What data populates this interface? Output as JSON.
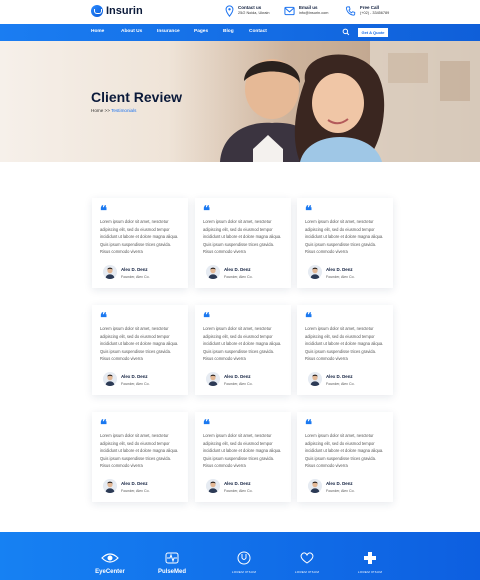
{
  "brand": {
    "name": "Insurin"
  },
  "contact": [
    {
      "icon": "location-pin-icon",
      "label": "Contact us",
      "value": "25/2 Noida, Ukrain"
    },
    {
      "icon": "email-icon",
      "label": "Email us",
      "value": "info@insurin.com"
    },
    {
      "icon": "phone-icon",
      "label": "Free Call",
      "value": "(+02) - 33456789"
    }
  ],
  "nav": {
    "items": [
      "Home",
      "About Us",
      "Insurance",
      "Pages",
      "Blog",
      "Contact"
    ],
    "cta": "Get A Quote"
  },
  "hero": {
    "title": "Client Review",
    "crumb_home": "Home",
    "crumb_sep": ">>",
    "crumb_current": "Testimonials"
  },
  "testimonials": [
    {
      "text": "Lorem ipsum dolor sit amet, nesctetur adipiscing elit, sed do eiusmod tempor incididunt ut labore et dolore magna aliqua. Quis ipsum suspendisse trices gravida. Risus commodo viverra",
      "name": "Alex D. Denz",
      "role": "Founder, Alex Co."
    },
    {
      "text": "Lorem ipsum dolor sit amet, nesctetur adipiscing elit, sed do eiusmod tempor incididunt ut labore et dolore magna aliqua. Quis ipsum suspendisse trices gravida. Risus commodo viverra",
      "name": "Alex D. Denz",
      "role": "Founder, Alex Co."
    },
    {
      "text": "Lorem ipsum dolor sit amet, nesctetur adipiscing elit, sed do eiusmod tempor incididunt ut labore et dolore magna aliqua. Quis ipsum suspendisse trices gravida. Risus commodo viverra",
      "name": "Alex D. Denz",
      "role": "Founder, Alex Co."
    },
    {
      "text": "Lorem ipsum dolor sit amet, nesctetur adipiscing elit, sed do eiusmod tempor incididunt ut labore et dolore magna aliqua. Quis ipsum suspendisse trices gravida. Risus commodo viverra",
      "name": "Alex D. Denz",
      "role": "Founder, Alex Co."
    },
    {
      "text": "Lorem ipsum dolor sit amet, nesctetur adipiscing elit, sed do eiusmod tempor incididunt ut labore et dolore magna aliqua. Quis ipsum suspendisse trices gravida. Risus commodo viverra",
      "name": "Alex D. Denz",
      "role": "Founder, Alex Co."
    },
    {
      "text": "Lorem ipsum dolor sit amet, nesctetur adipiscing elit, sed do eiusmod tempor incididunt ut labore et dolore magna aliqua. Quis ipsum suspendisse trices gravida. Risus commodo viverra",
      "name": "Alex D. Denz",
      "role": "Founder, Alex Co."
    },
    {
      "text": "Lorem ipsum dolor sit amet, nesctetur adipiscing elit, sed do eiusmod tempor incididunt ut labore et dolore magna aliqua. Quis ipsum suspendisse trices gravida. Risus commodo viverra",
      "name": "Alex D. Denz",
      "role": "Founder, Alex Co."
    },
    {
      "text": "Lorem ipsum dolor sit amet, nesctetur adipiscing elit, sed do eiusmod tempor incididunt ut labore et dolore magna aliqua. Quis ipsum suspendisse trices gravida. Risus commodo viverra",
      "name": "Alex D. Denz",
      "role": "Founder, Alex Co."
    },
    {
      "text": "Lorem ipsum dolor sit amet, nesctetur adipiscing elit, sed do eiusmod tempor incididunt ut labore et dolore magna aliqua. Quis ipsum suspendisse trices gravida. Risus commodo viverra",
      "name": "Alex D. Denz",
      "role": "Founder, Alex Co."
    }
  ],
  "quote_mark": "❝",
  "partners": [
    {
      "name": "EyeCenter",
      "tag": "",
      "icon": "eye-logo-icon"
    },
    {
      "name": "PulseMed",
      "tag": "",
      "icon": "pulse-logo-icon"
    },
    {
      "name": "LOREM IPSUM",
      "tag": "",
      "icon": "stethoscope-logo-icon"
    },
    {
      "name": "LOREM IPSUM",
      "tag": "",
      "icon": "heart-logo-icon"
    },
    {
      "name": "LOREM IPSUM",
      "tag": "",
      "icon": "cross-logo-icon"
    }
  ],
  "colors": {
    "primary": "#1a7df2",
    "dark": "#0b1a3a"
  }
}
